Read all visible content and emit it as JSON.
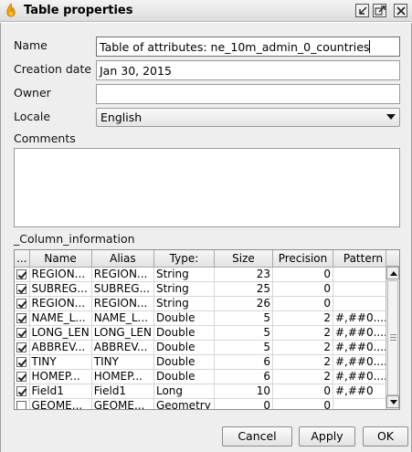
{
  "window": {
    "title": "Table properties",
    "icon": "app-flame-icon"
  },
  "form": {
    "name_label": "Name",
    "name_value": "Table of attributes: ne_10m_admin_0_countries",
    "creation_label": "Creation date",
    "creation_value": "Jan 30, 2015",
    "owner_label": "Owner",
    "owner_value": "",
    "locale_label": "Locale",
    "locale_value": "English",
    "comments_label": "Comments",
    "comments_value": ""
  },
  "columns": {
    "section_label": "_Column_information",
    "headers": [
      "...",
      "Name",
      "Alias",
      "Type:",
      "Size",
      "Precision",
      "Pattern"
    ],
    "rows": [
      {
        "checked": true,
        "name": "REGION...",
        "alias": "REGION...",
        "type": "String",
        "size": "23",
        "precision": "0",
        "pattern": ""
      },
      {
        "checked": true,
        "name": "SUBREG...",
        "alias": "SUBREG...",
        "type": "String",
        "size": "25",
        "precision": "0",
        "pattern": ""
      },
      {
        "checked": true,
        "name": "REGION...",
        "alias": "REGION...",
        "type": "String",
        "size": "26",
        "precision": "0",
        "pattern": ""
      },
      {
        "checked": true,
        "name": "NAME_L...",
        "alias": "NAME_L...",
        "type": "Double",
        "size": "5",
        "precision": "2",
        "pattern": "#,##0...."
      },
      {
        "checked": true,
        "name": "LONG_LEN",
        "alias": "LONG_LEN",
        "type": "Double",
        "size": "5",
        "precision": "2",
        "pattern": "#,##0...."
      },
      {
        "checked": true,
        "name": "ABBREV...",
        "alias": "ABBREV...",
        "type": "Double",
        "size": "5",
        "precision": "2",
        "pattern": "#,##0...."
      },
      {
        "checked": true,
        "name": "TINY",
        "alias": "TINY",
        "type": "Double",
        "size": "6",
        "precision": "2",
        "pattern": "#,##0...."
      },
      {
        "checked": true,
        "name": "HOMEP...",
        "alias": "HOMEP...",
        "type": "Double",
        "size": "6",
        "precision": "2",
        "pattern": "#,##0...."
      },
      {
        "checked": true,
        "name": "Field1",
        "alias": "Field1",
        "type": "Long",
        "size": "10",
        "precision": "0",
        "pattern": "#,##0"
      },
      {
        "checked": false,
        "name": "GEOME...",
        "alias": "GEOME...",
        "type": "Geometry",
        "size": "0",
        "precision": "0",
        "pattern": ""
      }
    ]
  },
  "buttons": {
    "cancel": "Cancel",
    "apply": "Apply",
    "ok": "OK"
  },
  "title_buttons": [
    "minimize-icon",
    "maximize-icon",
    "close-icon"
  ]
}
